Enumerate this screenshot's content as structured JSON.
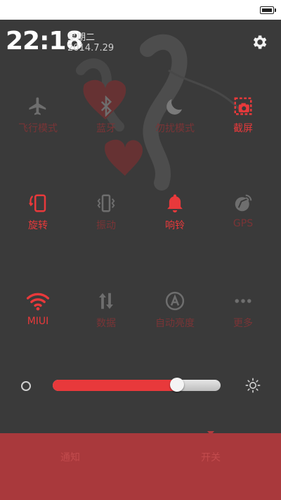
{
  "status_bar": {
    "battery_icon": "battery-icon"
  },
  "header": {
    "time": "22:18",
    "weekday": "星期二",
    "date": "2014.7.29",
    "settings_icon": "gear-icon"
  },
  "toggles": [
    {
      "label": "飞行模式",
      "icon": "airplane-icon",
      "active": false
    },
    {
      "label": "蓝牙",
      "icon": "bluetooth-icon",
      "active": false
    },
    {
      "label": "勿扰模式",
      "icon": "moon-icon",
      "active": false
    },
    {
      "label": "截屏",
      "icon": "screenshot-icon",
      "active": true
    },
    {
      "label": "旋转",
      "icon": "rotate-icon",
      "active": true
    },
    {
      "label": "振动",
      "icon": "vibrate-icon",
      "active": false
    },
    {
      "label": "响铃",
      "icon": "bell-icon",
      "active": true
    },
    {
      "label": "GPS",
      "icon": "gps-icon",
      "active": false
    },
    {
      "label": "MIUI",
      "icon": "wifi-icon",
      "active": true
    },
    {
      "label": "数据",
      "icon": "data-icon",
      "active": false
    },
    {
      "label": "自动亮度",
      "icon": "auto-brightness-icon",
      "active": false
    },
    {
      "label": "更多",
      "icon": "more-icon",
      "active": false
    }
  ],
  "brightness": {
    "level": 0.74
  },
  "bottom_tabs": {
    "notifications": "通知",
    "switches": "开关"
  },
  "colors": {
    "accent": "#e8393b",
    "inactive": "#6e6e6e",
    "footer": "#a9393c"
  }
}
